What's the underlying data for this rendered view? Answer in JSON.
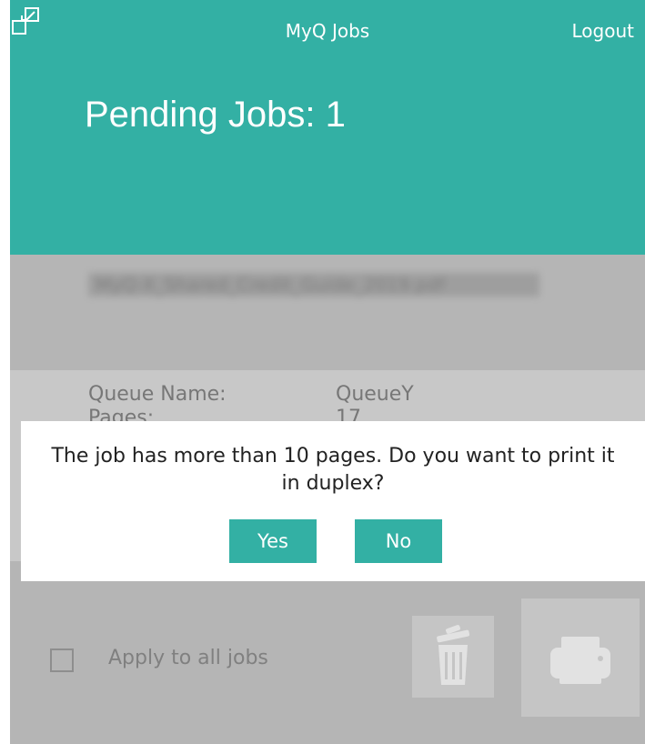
{
  "header": {
    "app_title": "MyQ Jobs",
    "logout_label": "Logout",
    "pending_title": "Pending Jobs: 1"
  },
  "job": {
    "name_blurred": "MyQ-X_Shared_Credit_Guide_2019.pdf",
    "details": [
      {
        "label": "Queue Name:",
        "value": "QueueY"
      },
      {
        "label": "Pages:",
        "value": "17"
      }
    ]
  },
  "dialog": {
    "message": "The job has more than 10 pages. Do you want to print it in duplex?",
    "yes_label": "Yes",
    "no_label": "No"
  },
  "footer": {
    "apply_all_label": "Apply to all jobs",
    "apply_all_checked": false
  },
  "colors": {
    "accent": "#33b0a4",
    "overlay_gray": "#b5b5b5"
  }
}
